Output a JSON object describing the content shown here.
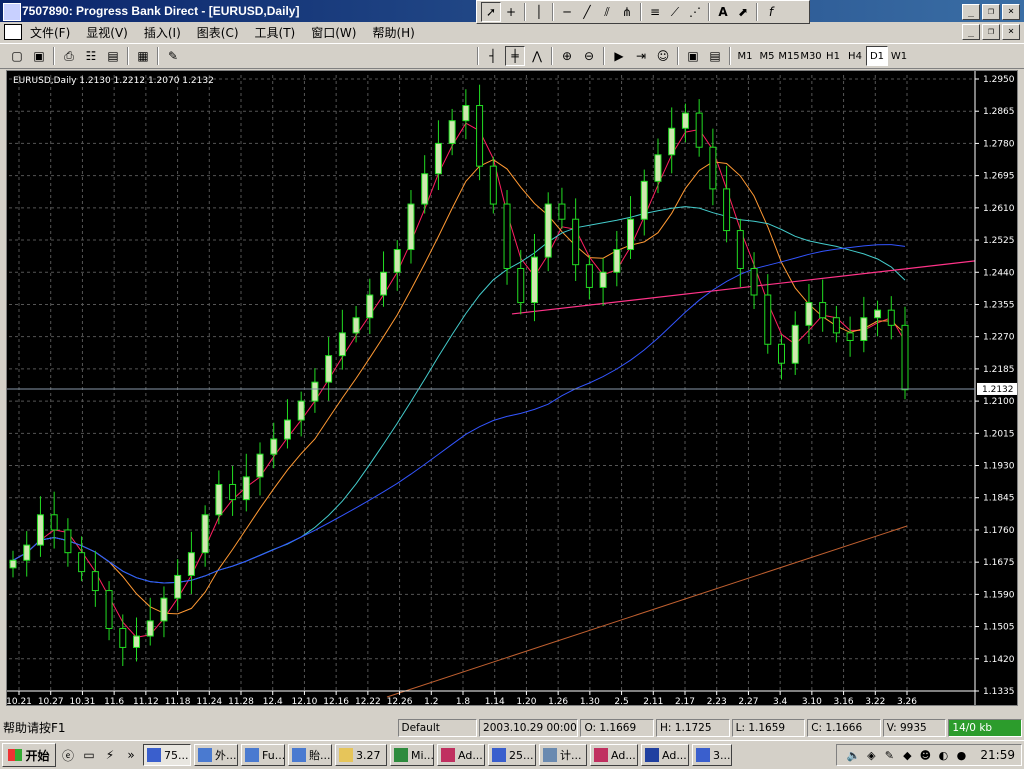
{
  "window": {
    "title": "7507890: Progress Bank Direct - [EURUSD,Daily]"
  },
  "menu": [
    "文件(F)",
    "显视(V)",
    "插入(I)",
    "图表(C)",
    "工具(T)",
    "窗口(W)",
    "帮助(H)"
  ],
  "drawing_toolbar": [
    "cursor",
    "crosshair",
    "vertical-line",
    "horizontal-line",
    "trendline",
    "angle-line",
    "pitchfork",
    "fibonacci",
    "gann-line",
    "gann-fan",
    "text",
    "arrow",
    "more"
  ],
  "periods": [
    "M1",
    "M5",
    "M15",
    "M30",
    "H1",
    "H4",
    "D1",
    "W1"
  ],
  "active_period": "D1",
  "chart_header": "EURUSD,Daily  1.2130 1.2212 1.2070 1.2132",
  "current_price": "1.2132",
  "chart_data": {
    "type": "candlestick",
    "symbol": "EURUSD",
    "timeframe": "Daily",
    "ohlc_header": {
      "open": 1.213,
      "high": 1.2212,
      "low": 1.207,
      "close": 1.2132
    },
    "y_ticks": [
      "1.2950",
      "1.2865",
      "1.2780",
      "1.2695",
      "1.2610",
      "1.2525",
      "1.2440",
      "1.2355",
      "1.2270",
      "1.2185",
      "1.2100",
      "1.2015",
      "1.1930",
      "1.1845",
      "1.1760",
      "1.1675",
      "1.1590",
      "1.1505",
      "1.1420",
      "1.1335"
    ],
    "ylim": [
      1.1335,
      1.295
    ],
    "x_ticks": [
      "10.21",
      "10.27",
      "10.31",
      "11.6",
      "11.12",
      "11.18",
      "11.24",
      "11.28",
      "12.4",
      "12.10",
      "12.16",
      "12.22",
      "12.26",
      "1.2",
      "1.8",
      "1.14",
      "1.20",
      "1.26",
      "1.30",
      "2.5",
      "2.11",
      "2.17",
      "2.23",
      "2.27",
      "3.4",
      "3.10",
      "3.16",
      "3.22",
      "3.26"
    ],
    "grid": true,
    "close_series_estimate": [
      1.168,
      1.172,
      1.18,
      1.176,
      1.17,
      1.165,
      1.16,
      1.15,
      1.145,
      1.148,
      1.152,
      1.158,
      1.164,
      1.17,
      1.18,
      1.188,
      1.184,
      1.19,
      1.196,
      1.2,
      1.205,
      1.21,
      1.215,
      1.222,
      1.228,
      1.232,
      1.238,
      1.244,
      1.25,
      1.262,
      1.27,
      1.278,
      1.284,
      1.288,
      1.272,
      1.262,
      1.245,
      1.236,
      1.248,
      1.262,
      1.258,
      1.246,
      1.24,
      1.244,
      1.25,
      1.258,
      1.268,
      1.275,
      1.282,
      1.286,
      1.277,
      1.266,
      1.255,
      1.245,
      1.238,
      1.225,
      1.22,
      1.23,
      1.236,
      1.232,
      1.228,
      1.226,
      1.232,
      1.234,
      1.23,
      1.213
    ],
    "lines": [
      "moving averages (red, orange, cyan, blue, brown)",
      "pink neckline trendline"
    ],
    "colors": {
      "bull": "#cfe8b0",
      "bear": "#000000",
      "candle_outline": "#22dd22",
      "grid": "#555555",
      "text": "#ffffff"
    }
  },
  "status": {
    "help": "帮助请按F1",
    "profile": "Default",
    "time": "2003.10.29 00:00",
    "open": "O: 1.1669",
    "high": "H: 1.1725",
    "low": "L: 1.1659",
    "close": "C: 1.1666",
    "volume": "V: 9935",
    "traffic": "14/0 kb"
  },
  "taskbar": {
    "start": "开始",
    "tasks": [
      "75...",
      "外...",
      "Fu...",
      "貽...",
      "3.27",
      "Mi...",
      "Ad...",
      "25...",
      "计...",
      "Ad...",
      "Ad...",
      "3..."
    ],
    "active_task": 0,
    "clock": "21:59"
  }
}
